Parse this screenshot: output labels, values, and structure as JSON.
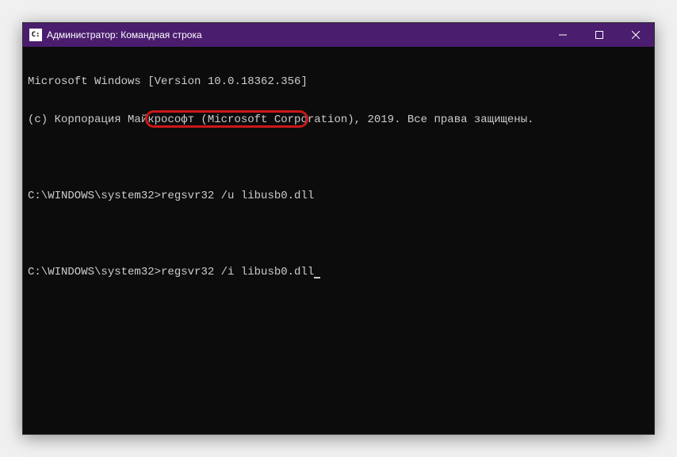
{
  "window": {
    "title": "Администратор: Командная строка",
    "icon_label": "cmd-icon"
  },
  "terminal": {
    "line1": "Microsoft Windows [Version 10.0.18362.356]",
    "line2": "(c) Корпорация Майкрософт (Microsoft Corporation), 2019. Все права защищены.",
    "prompt": "C:\\WINDOWS\\system32>",
    "cmd1": "regsvr32 /u libusb0.dll",
    "cmd2": "regsvr32 /i libusb0.dll"
  }
}
